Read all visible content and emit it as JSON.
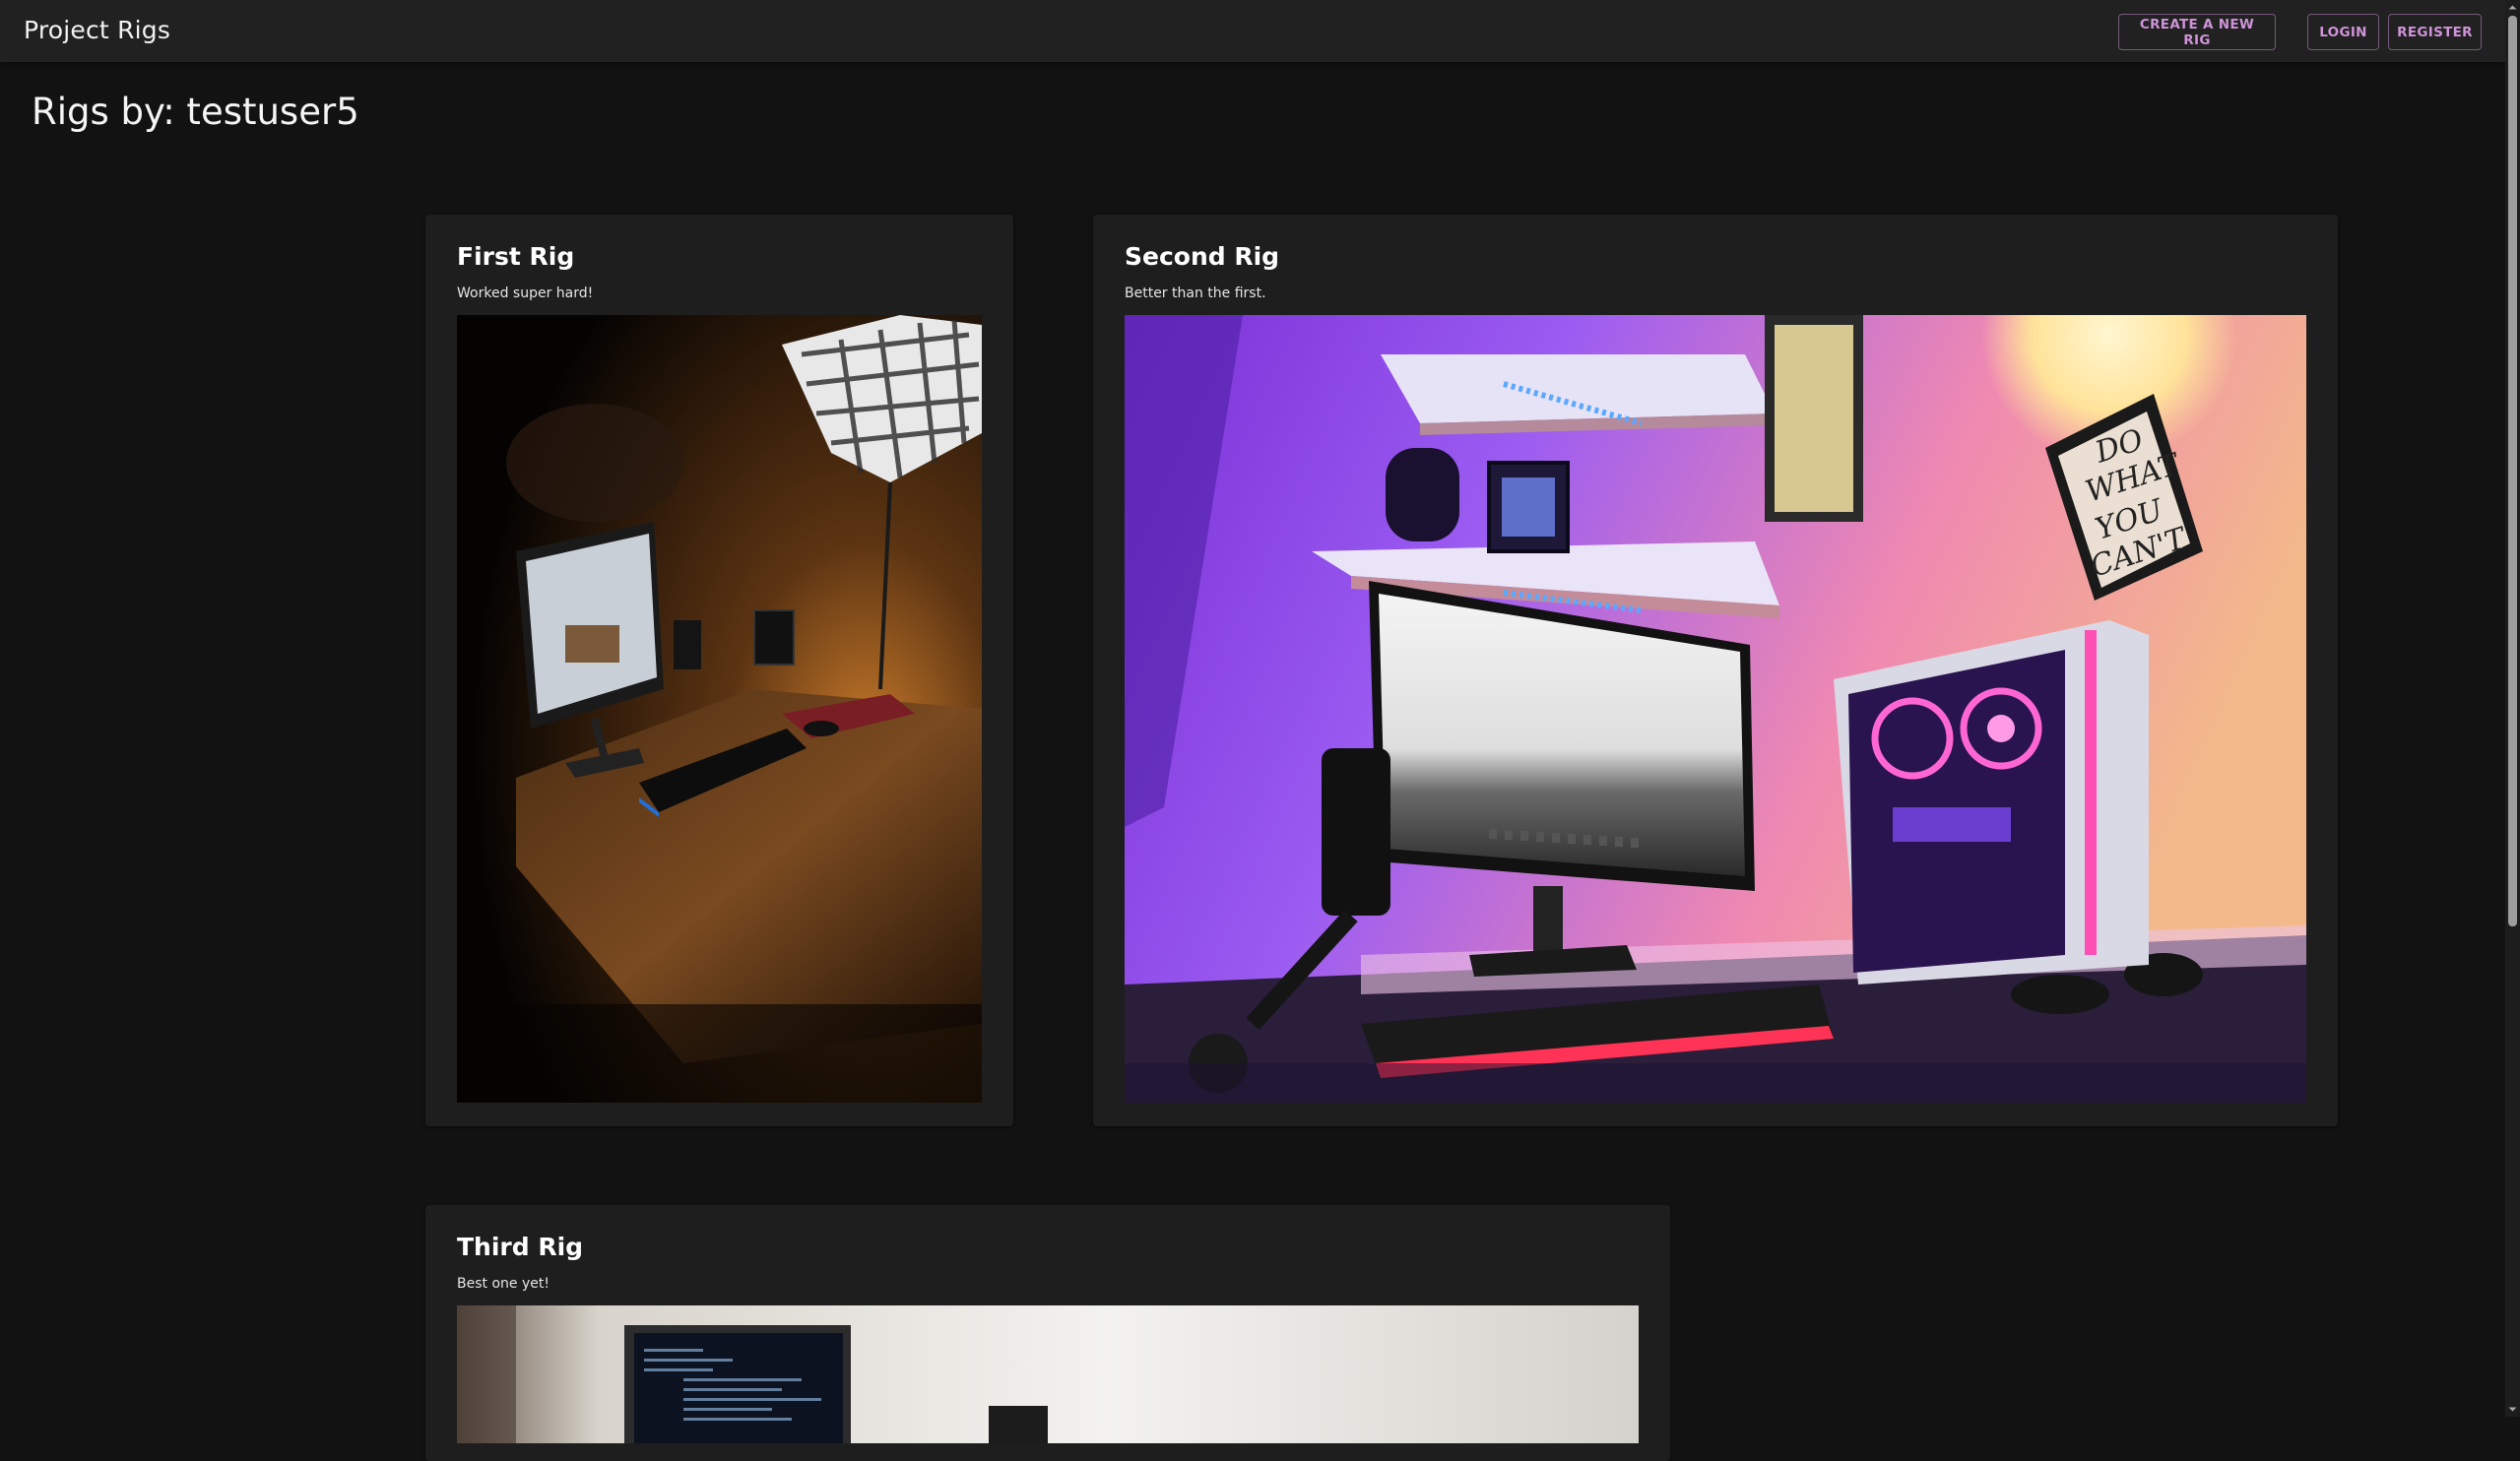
{
  "nav": {
    "brand": "Project Rigs",
    "create_label": "Create a new rig",
    "login_label": "Login",
    "register_label": "Register",
    "accent_color": "#ce93d8"
  },
  "page": {
    "title": "Rigs by: testuser5"
  },
  "rigs": [
    {
      "title": "First Rig",
      "description": "Worked super hard!",
      "image_icon": "desk-photo-dark"
    },
    {
      "title": "Second Rig",
      "description": "Better than the first.",
      "image_icon": "desk-photo-neon"
    },
    {
      "title": "Third Rig",
      "description": "Best one yet!",
      "image_icon": "desk-photo-bright"
    }
  ],
  "poster": {
    "line1": "DO",
    "line2": "WHAT",
    "line3": "YOU",
    "line4": "CAN'T"
  },
  "theme": {
    "background": "#121212",
    "appbar": "#212121",
    "card": "#1e1e1e"
  }
}
